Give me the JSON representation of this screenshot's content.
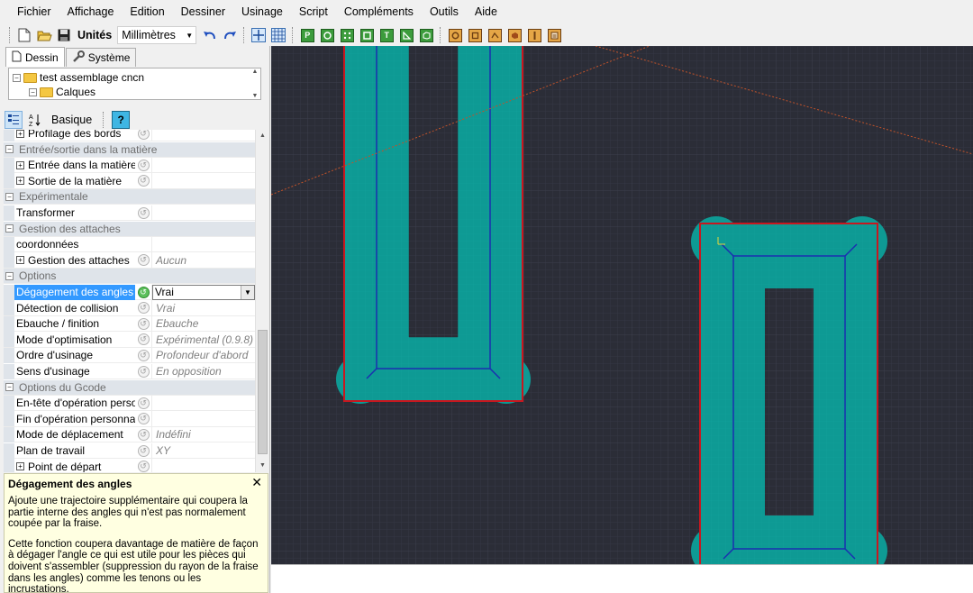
{
  "menu": [
    "Fichier",
    "Affichage",
    "Edition",
    "Dessiner",
    "Usinage",
    "Script",
    "Compléments",
    "Outils",
    "Aide"
  ],
  "toolbar": {
    "units_label": "Unités",
    "units_value": "Millimètres",
    "primitives_icons": [
      "P",
      "circle",
      "dots",
      "square",
      "T",
      "polygon",
      "box"
    ]
  },
  "tabs": [
    {
      "label": "Dessin",
      "icon": "document-icon"
    },
    {
      "label": "Système",
      "icon": "wrench-icon"
    }
  ],
  "tree": {
    "root": "test assemblage cncn",
    "child": "Calques"
  },
  "props_toolbar": {
    "basic_label": "Basique",
    "help_label": "?"
  },
  "grid_rows": [
    {
      "type": "prop",
      "name": "Profilage des bords",
      "expand": true,
      "value": ""
    },
    {
      "type": "cat",
      "name": "Entrée/sortie dans la matière"
    },
    {
      "type": "prop",
      "name": "Entrée dans la matière",
      "expand": true,
      "value": ""
    },
    {
      "type": "prop",
      "name": "Sortie de la matière",
      "expand": true,
      "value": ""
    },
    {
      "type": "cat",
      "name": "Expérimentale"
    },
    {
      "type": "prop",
      "name": "Transformer",
      "expand": false,
      "value": ""
    },
    {
      "type": "cat",
      "name": "Gestion des attaches"
    },
    {
      "type": "prop",
      "name": "coordonnées",
      "expand": false,
      "value": "",
      "nobtn": true
    },
    {
      "type": "prop",
      "name": "Gestion des attaches",
      "expand": true,
      "value": "Aucun"
    },
    {
      "type": "cat",
      "name": "Options"
    },
    {
      "type": "prop",
      "name": "Dégagement des angles",
      "expand": false,
      "value": "Vrai",
      "selected": true
    },
    {
      "type": "prop",
      "name": "Détection de collision",
      "expand": false,
      "value": "Vrai"
    },
    {
      "type": "prop",
      "name": "Ebauche / finition",
      "expand": false,
      "value": "Ebauche"
    },
    {
      "type": "prop",
      "name": "Mode d'optimisation",
      "expand": false,
      "value": "Expérimental (0.9.8)"
    },
    {
      "type": "prop",
      "name": "Ordre d'usinage",
      "expand": false,
      "value": "Profondeur d'abord"
    },
    {
      "type": "prop",
      "name": "Sens d'usinage",
      "expand": false,
      "value": "En opposition"
    },
    {
      "type": "cat",
      "name": "Options du Gcode"
    },
    {
      "type": "prop",
      "name": "En-tête d'opération personnalisé",
      "expand": false,
      "value": ""
    },
    {
      "type": "prop",
      "name": "Fin d'opération personnalisée",
      "expand": false,
      "value": ""
    },
    {
      "type": "prop",
      "name": "Mode de déplacement",
      "expand": false,
      "value": "Indéfini"
    },
    {
      "type": "prop",
      "name": "Plan de travail",
      "expand": false,
      "value": "XY"
    },
    {
      "type": "prop",
      "name": "Point de départ",
      "expand": true,
      "value": ""
    }
  ],
  "description": {
    "title": "Dégagement des angles",
    "p1": "Ajoute une trajectoire supplémentaire qui coupera la partie interne des angles qui n'est pas normalement coupée par la fraise.",
    "p2": "Cette fonction coupera davantage de matière de façon à dégager l'angle ce qui est utile pour les pièces qui doivent s'assembler (suppression du rayon de la fraise dans les angles) comme les tenons ou les incrustations."
  },
  "colors": {
    "canvas_bg": "#2b2d37",
    "toolpath_fill": "#0e9a94",
    "outline_red": "#c8171f",
    "path_blue": "#1a2fb0",
    "selection_blue": "#3399ff"
  }
}
